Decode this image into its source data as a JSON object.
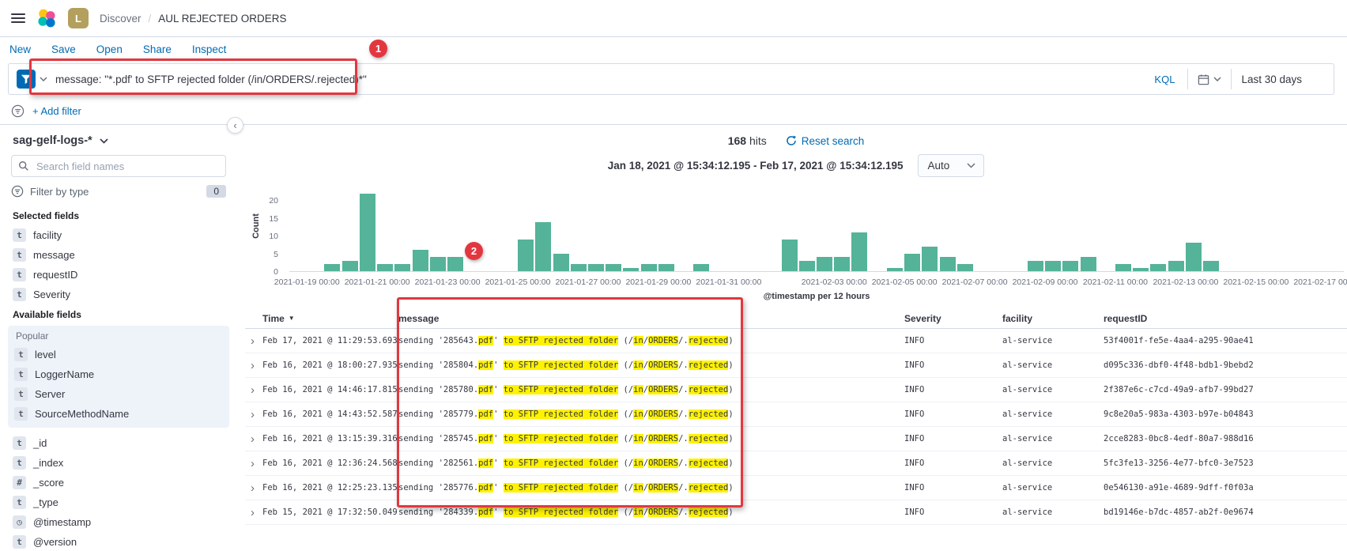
{
  "header": {
    "breadcrumb_section": "Discover",
    "breadcrumb_separator": "/",
    "breadcrumb_page": "AUL REJECTED ORDERS",
    "space_badge": "L"
  },
  "menu": {
    "items": [
      "New",
      "Save",
      "Open",
      "Share",
      "Inspect"
    ]
  },
  "search": {
    "query": "message: \"*.pdf' to SFTP rejected folder (/in/ORDERS/.rejected)*\"",
    "kql_label": "KQL",
    "time_range": "Last 30 days"
  },
  "filter_bar": {
    "add_filter_label": "+ Add filter"
  },
  "sidebar": {
    "index_pattern": "sag-gelf-logs-*",
    "search_placeholder": "Search field names",
    "filter_by_type_label": "Filter by type",
    "filter_count": "0",
    "selected_fields_label": "Selected fields",
    "available_fields_label": "Available fields",
    "popular_label": "Popular",
    "collapse_icon": "‹",
    "selected_fields": [
      {
        "name": "facility",
        "glyph": "t"
      },
      {
        "name": "message",
        "glyph": "t"
      },
      {
        "name": "requestID",
        "glyph": "t"
      },
      {
        "name": "Severity",
        "glyph": "t"
      }
    ],
    "popular_fields": [
      {
        "name": "level",
        "glyph": "t"
      },
      {
        "name": "LoggerName",
        "glyph": "t"
      },
      {
        "name": "Server",
        "glyph": "t"
      },
      {
        "name": "SourceMethodName",
        "glyph": "t"
      }
    ],
    "other_fields": [
      {
        "name": "_id",
        "glyph": "t"
      },
      {
        "name": "_index",
        "glyph": "t"
      },
      {
        "name": "_score",
        "glyph": "#"
      },
      {
        "name": "_type",
        "glyph": "t"
      },
      {
        "name": "@timestamp",
        "glyph": "◷"
      },
      {
        "name": "@version",
        "glyph": "t"
      }
    ]
  },
  "results": {
    "hits_count": "168",
    "hits_label": "hits",
    "reset_search_label": "Reset search",
    "time_range_display": "Jan 18, 2021 @ 15:34:12.195 - Feb 17, 2021 @ 15:34:12.195",
    "interval_selector": "Auto"
  },
  "chart_data": {
    "type": "bar",
    "title": "",
    "ylabel": "Count",
    "xlabel": "@timestamp per 12 hours",
    "ylim": [
      0,
      24
    ],
    "yticks": [
      0,
      5,
      10,
      15,
      20
    ],
    "xlim": [
      "2021-01-18T12:00",
      "2021-02-17T12:00"
    ],
    "xticks": [
      "2021-01-19 00:00",
      "2021-01-21 00:00",
      "2021-01-23 00:00",
      "2021-01-25 00:00",
      "2021-01-27 00:00",
      "2021-01-29 00:00",
      "2021-01-31 00:00",
      "2021-02-03 00:00",
      "2021-02-05 00:00",
      "2021-02-07 00:00",
      "2021-02-09 00:00",
      "2021-02-11 00:00",
      "2021-02-13 00:00",
      "2021-02-15 00:00",
      "2021-02-17 00:00"
    ],
    "bucket_interval": "12h",
    "bar_color": "#54b399",
    "grid": false,
    "legend": false,
    "buckets": [
      {
        "x": "2021-01-19T12:00",
        "y": 2
      },
      {
        "x": "2021-01-20T00:00",
        "y": 3
      },
      {
        "x": "2021-01-20T12:00",
        "y": 22
      },
      {
        "x": "2021-01-21T00:00",
        "y": 2
      },
      {
        "x": "2021-01-21T12:00",
        "y": 2
      },
      {
        "x": "2021-01-22T00:00",
        "y": 6
      },
      {
        "x": "2021-01-22T12:00",
        "y": 4
      },
      {
        "x": "2021-01-23T00:00",
        "y": 4
      },
      {
        "x": "2021-01-25T00:00",
        "y": 9
      },
      {
        "x": "2021-01-25T12:00",
        "y": 14
      },
      {
        "x": "2021-01-26T00:00",
        "y": 5
      },
      {
        "x": "2021-01-26T12:00",
        "y": 2
      },
      {
        "x": "2021-01-27T00:00",
        "y": 2
      },
      {
        "x": "2021-01-27T12:00",
        "y": 2
      },
      {
        "x": "2021-01-28T00:00",
        "y": 1
      },
      {
        "x": "2021-01-28T12:00",
        "y": 2
      },
      {
        "x": "2021-01-29T00:00",
        "y": 2
      },
      {
        "x": "2021-01-30T00:00",
        "y": 2
      },
      {
        "x": "2021-02-01T12:00",
        "y": 9
      },
      {
        "x": "2021-02-02T00:00",
        "y": 3
      },
      {
        "x": "2021-02-02T12:00",
        "y": 4
      },
      {
        "x": "2021-02-03T00:00",
        "y": 4
      },
      {
        "x": "2021-02-03T12:00",
        "y": 11
      },
      {
        "x": "2021-02-04T12:00",
        "y": 1
      },
      {
        "x": "2021-02-05T00:00",
        "y": 5
      },
      {
        "x": "2021-02-05T12:00",
        "y": 7
      },
      {
        "x": "2021-02-06T00:00",
        "y": 4
      },
      {
        "x": "2021-02-06T12:00",
        "y": 2
      },
      {
        "x": "2021-02-08T12:00",
        "y": 3
      },
      {
        "x": "2021-02-09T00:00",
        "y": 3
      },
      {
        "x": "2021-02-09T12:00",
        "y": 3
      },
      {
        "x": "2021-02-10T00:00",
        "y": 4
      },
      {
        "x": "2021-02-11T00:00",
        "y": 2
      },
      {
        "x": "2021-02-11T12:00",
        "y": 1
      },
      {
        "x": "2021-02-12T00:00",
        "y": 2
      },
      {
        "x": "2021-02-12T12:00",
        "y": 3
      },
      {
        "x": "2021-02-13T00:00",
        "y": 8
      },
      {
        "x": "2021-02-13T12:00",
        "y": 3
      }
    ]
  },
  "table": {
    "columns": [
      "Time",
      "message",
      "Severity",
      "facility",
      "requestID"
    ],
    "sorted_column": "Time",
    "sort_icon": "▼",
    "expand_icon": "›",
    "highlight_color": "#fff200",
    "message_template": [
      {
        "text": "sending '{n}.",
        "hl": false
      },
      {
        "text": "pdf",
        "hl": true
      },
      {
        "text": "' ",
        "hl": false
      },
      {
        "text": "to SFTP rejected folder",
        "hl": true
      },
      {
        "text": " (/",
        "hl": false
      },
      {
        "text": "in",
        "hl": true
      },
      {
        "text": "/",
        "hl": false
      },
      {
        "text": "ORDERS",
        "hl": true
      },
      {
        "text": "/.",
        "hl": false
      },
      {
        "text": "rejected",
        "hl": true
      },
      {
        "text": ")",
        "hl": false
      }
    ],
    "rows": [
      {
        "time": "Feb 17, 2021 @ 11:29:53.693",
        "file": "285643",
        "severity": "INFO",
        "facility": "al-service",
        "request_id": "53f4001f-fe5e-4aa4-a295-90ae41"
      },
      {
        "time": "Feb 16, 2021 @ 18:00:27.935",
        "file": "285804",
        "severity": "INFO",
        "facility": "al-service",
        "request_id": "d095c336-dbf0-4f48-bdb1-9bebd2"
      },
      {
        "time": "Feb 16, 2021 @ 14:46:17.815",
        "file": "285780",
        "severity": "INFO",
        "facility": "al-service",
        "request_id": "2f387e6c-c7cd-49a9-afb7-99bd27"
      },
      {
        "time": "Feb 16, 2021 @ 14:43:52.587",
        "file": "285779",
        "severity": "INFO",
        "facility": "al-service",
        "request_id": "9c8e20a5-983a-4303-b97e-b04843"
      },
      {
        "time": "Feb 16, 2021 @ 13:15:39.316",
        "file": "285745",
        "severity": "INFO",
        "facility": "al-service",
        "request_id": "2cce8283-0bc8-4edf-80a7-988d16"
      },
      {
        "time": "Feb 16, 2021 @ 12:36:24.568",
        "file": "282561",
        "severity": "INFO",
        "facility": "al-service",
        "request_id": "5fc3fe13-3256-4e77-bfc0-3e7523"
      },
      {
        "time": "Feb 16, 2021 @ 12:25:23.135",
        "file": "285776",
        "severity": "INFO",
        "facility": "al-service",
        "request_id": "0e546130-a91e-4689-9dff-f0f03a"
      },
      {
        "time": "Feb 15, 2021 @ 17:32:50.049",
        "file": "284339",
        "severity": "INFO",
        "facility": "al-service",
        "request_id": "bd19146e-b7dc-4857-ab2f-0e9674"
      }
    ]
  },
  "annotations": {
    "step1": "1",
    "step2": "2",
    "color": "#e2373f"
  }
}
